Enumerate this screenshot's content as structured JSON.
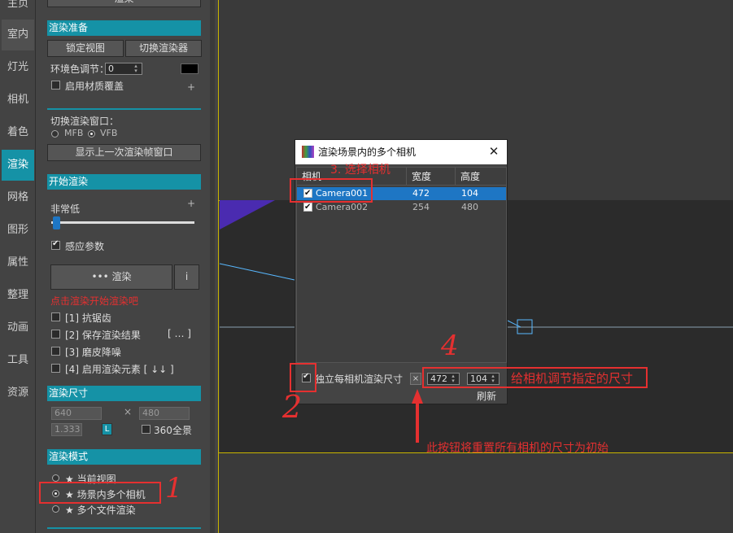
{
  "nav": {
    "items": [
      "主页",
      "室内",
      "灯光",
      "相机",
      "着色",
      "渲染",
      "网格",
      "图形",
      "属性",
      "整理",
      "动画",
      "工具",
      "资源"
    ],
    "active_index": 5
  },
  "panel": {
    "top_button": "渲染",
    "prep": {
      "header": "渲染准备",
      "lock_view": "锁定视图",
      "switch_renderer": "切换渲染器",
      "env_label": "环境色调节：",
      "env_value": "0",
      "env_plus": "+",
      "material_override": "启用材质覆盖",
      "material_plus": "+"
    },
    "window": {
      "label": "切换渲染窗口：",
      "mfb": "MFB",
      "vfb": "VFB",
      "show_last": "显示上一次渲染帧窗口"
    },
    "start": {
      "header": "开始渲染",
      "quality": "非常低",
      "plus": "+",
      "sense_param": "感应参数",
      "render_btn": "••• 渲染",
      "info_btn": "i",
      "hint": "点击渲染开始渲染吧",
      "opt1": "[1] 抗锯齿",
      "opt2": "[2] 保存渲染结果",
      "opt2_extra": "[ … ]",
      "opt3": "[3] 磨皮降噪",
      "opt4": "[4] 启用渲染元素 [ ↓↓ ]"
    },
    "size": {
      "header": "渲染尺寸",
      "width": "640",
      "x": "×",
      "height": "480",
      "ratio": "1.333",
      "lock": "L",
      "full360": "360全景"
    },
    "mode": {
      "header": "渲染模式",
      "opt_current": "★ 当前视图",
      "opt_multi_cam": "★ 场景内多个相机",
      "opt_multi_file": "★ 多个文件渲染"
    }
  },
  "dialog": {
    "title": "渲染场景内的多个相机",
    "close": "✕",
    "columns": [
      "相机",
      "宽度",
      "高度"
    ],
    "rows": [
      {
        "name": "Camera001",
        "width": "472",
        "height": "104",
        "selected": true
      },
      {
        "name": "Camera002",
        "width": "254",
        "height": "480",
        "selected": false
      }
    ],
    "independent_size": "独立每相机渲染尺寸",
    "reset": "×",
    "width_value": "472",
    "height_value": "104",
    "refresh": "刷新"
  },
  "annotations": {
    "step3": "3. 选择相机",
    "step4": "4",
    "step2": "2",
    "step1": "1",
    "adjust": "给相机调节指定的尺寸",
    "reset_note": "此按钮将重置所有相机的尺寸为初始"
  },
  "colors": {
    "accent": "#1592a6",
    "selection": "#1e76c4",
    "annotation": "#e53030"
  }
}
